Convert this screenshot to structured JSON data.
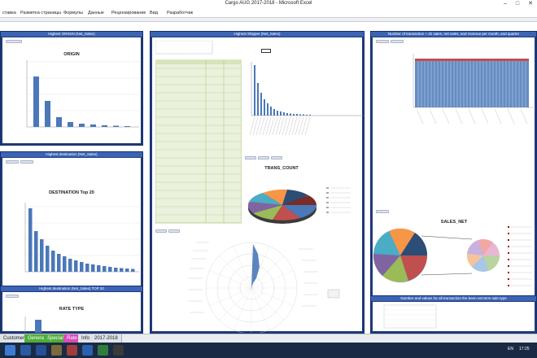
{
  "window": {
    "title": "Cargo AUG 2017-2018  -  Microsoft Excel",
    "minimize": "–",
    "maximize": "□",
    "close": "✕"
  },
  "ribbon": {
    "tabs": [
      "ставка",
      "Разметка страницы",
      "Формулы",
      "Данные",
      "Рецензирование",
      "Вид",
      "Разработчик"
    ]
  },
  "panels": {
    "origin": {
      "header": "Highest ORIGIN (Net_Sales)",
      "title": "ORIGIN"
    },
    "destination": {
      "header": "Highest destination (Net_Sales)",
      "title": "DESTINATION Top 20"
    },
    "rate": {
      "header": "Highest destination (Net_Sales) TOP 20",
      "title": "RATE TYPE"
    },
    "shipper": {
      "header": "Highest Shipper (Net_Sales)"
    },
    "trans": {
      "title": "TRANS_COUNT"
    },
    "sales": {
      "header": "Number of transaction + dn sales, net sales, and revenue per month, and quarter",
      "title": "SALES_NET"
    },
    "bottomright": {
      "header": "Number and values for all transaction the been net term sale type"
    }
  },
  "sheet_tabs": [
    {
      "label": "Customers",
      "style": "plain"
    },
    {
      "label": "General",
      "style": "green"
    },
    {
      "label": "Special",
      "style": "green"
    },
    {
      "label": "Rate",
      "style": "pink"
    },
    {
      "label": "Info",
      "style": "plain"
    },
    {
      "label": "2017-2018",
      "style": "plain"
    }
  ],
  "taskbar": {
    "clock": "17:25",
    "lang": "EN"
  },
  "colors": {
    "panel": "#1f3b78",
    "bar": "#4a78b8",
    "accent": "#3b64b5"
  }
}
